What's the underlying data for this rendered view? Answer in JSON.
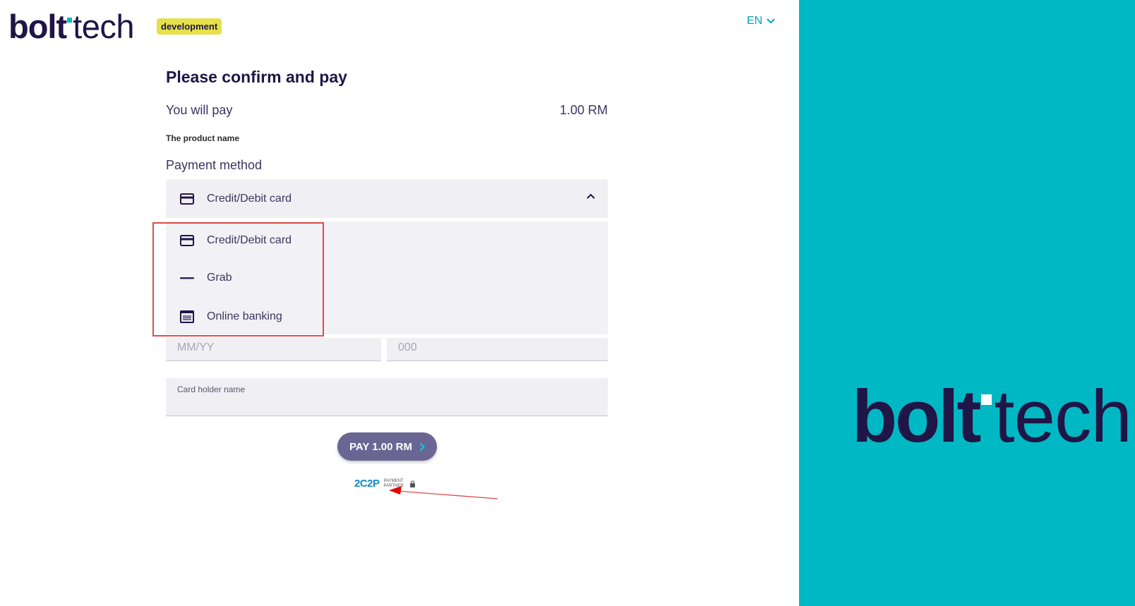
{
  "header": {
    "logo_bold": "bolt",
    "logo_light": "tech",
    "env_badge": "development",
    "language": "EN"
  },
  "checkout": {
    "title": "Please confirm and pay",
    "you_will_pay_label": "You will pay",
    "amount": "1.00 RM",
    "product_name": "The product name",
    "payment_method_label": "Payment method",
    "selected_method": "Credit/Debit card",
    "methods": [
      {
        "label": "Credit/Debit card",
        "icon": "credit-card-icon"
      },
      {
        "label": "Grab",
        "icon": "grabpay-icon"
      },
      {
        "label": "Online banking",
        "icon": "online-banking-icon"
      }
    ],
    "expiry_placeholder": "MM/YY",
    "cvv_placeholder": "000",
    "card_holder_label": "Card holder name",
    "pay_button": "PAY 1.00 RM",
    "partner_logo": "2C2P",
    "partner_caption": "PAYMENT PARTNER"
  },
  "brand_panel": {
    "logo_bold": "bolt",
    "logo_light": "tech",
    "background": "#00b8c4"
  },
  "colors": {
    "primary_navy": "#1f1547",
    "accent_teal": "#00b8c4",
    "badge_yellow": "#e6e04a",
    "button_purple": "#6a6593",
    "annotation_red": "#e24b4b"
  }
}
